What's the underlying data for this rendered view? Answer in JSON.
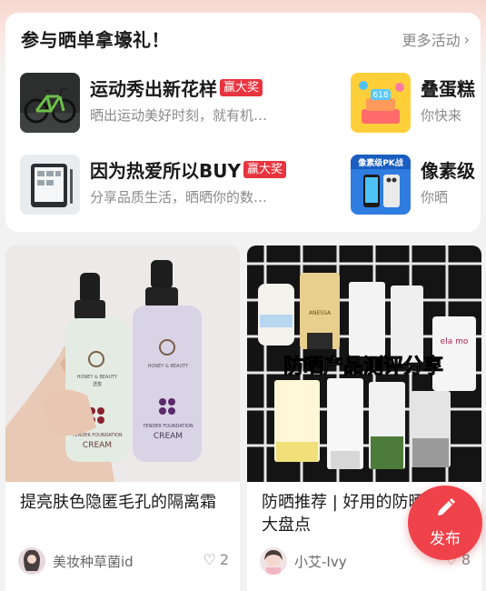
{
  "activity": {
    "title": "参与晒单拿壕礼！",
    "more_label": "更多活动",
    "campaigns": [
      {
        "title": "运动秀出新花样",
        "badge": "赢大奖",
        "desc": "晒出运动美好时刻，就有机…"
      },
      {
        "title": "叠蛋糕",
        "desc": "你快来"
      },
      {
        "title": "因为热爱所以BUY",
        "badge": "赢大奖",
        "desc": "分享品质生活，晒晒你的数…"
      },
      {
        "title": "像素级",
        "desc": "你晒"
      }
    ],
    "thumb_texts": {
      "cake": "618",
      "pixel": "像素级PK战"
    }
  },
  "feed": {
    "posts": [
      {
        "title": "提亮肤色隐匿毛孔的隔离霜",
        "author": "美妆种草菌id",
        "likes": "2",
        "image_texts": {
          "brand": "HONEY & BEAUTY",
          "cn": "透蜜",
          "product": "TENDER FOUNDATION",
          "line": "CREAM"
        }
      },
      {
        "title": "防晒推荐 | 好用的防晒产品大盘点",
        "author": "小艾-Ivy",
        "likes": "8",
        "image_texts": {
          "overlay": "防晒产品测评分享",
          "anessa": "ANESSA",
          "ela": "ela mo"
        }
      }
    ]
  },
  "fab": {
    "label": "发布"
  },
  "colors": {
    "accent": "#f0424a",
    "badge": "#e8343f",
    "muted": "#8a8a8a"
  }
}
